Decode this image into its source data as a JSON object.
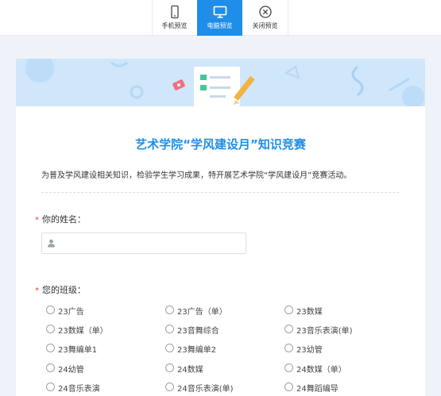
{
  "toolbar": {
    "tabs": [
      {
        "label": "手机预览",
        "icon": "phone-icon",
        "active": false
      },
      {
        "label": "电脑预览",
        "icon": "monitor-icon",
        "active": true
      },
      {
        "label": "关闭预览",
        "icon": "close-circle-icon",
        "active": false
      }
    ]
  },
  "form": {
    "title": "艺术学院“学风建设月”知识竞赛",
    "description": "为普及学风建设相关知识，检验学生学习成果，特开展艺术学院“学风建设月”竞赛活动。",
    "questions": {
      "name": {
        "required_mark": "*",
        "label": "你的姓名：",
        "value": "",
        "icon": "user-icon"
      },
      "class": {
        "required_mark": "*",
        "label": "您的班级：",
        "options": [
          "23广告",
          "23广告（单）",
          "23数媒",
          "23数媒（单）",
          "23音舞综合",
          "23音乐表演(单)",
          "23舞编单1",
          "23舞编单2",
          "23幼管",
          "24幼管",
          "24数媒",
          "24数媒（单）",
          "24音乐表演",
          "24音乐表演(单)",
          "24舞蹈编导"
        ]
      }
    }
  },
  "colors": {
    "accent": "#1f8ee8",
    "banner": "#cfe6fb",
    "required": "#e23b3b",
    "page_bg": "#eef3f9"
  }
}
